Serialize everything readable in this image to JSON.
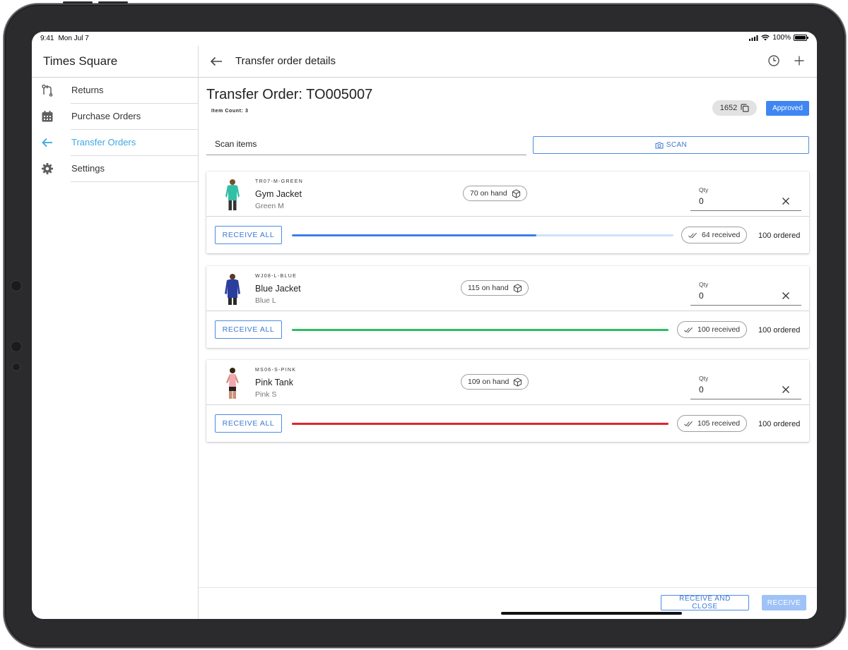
{
  "status_bar": {
    "time": "9:41",
    "date": "Mon Jul 7",
    "battery": "100%"
  },
  "sidebar": {
    "title": "Times Square",
    "items": [
      {
        "label": "Returns",
        "icon": "returns-icon",
        "active": false
      },
      {
        "label": "Purchase Orders",
        "icon": "calendar-icon",
        "active": false
      },
      {
        "label": "Transfer Orders",
        "icon": "arrow-left-icon",
        "active": true
      },
      {
        "label": "Settings",
        "icon": "gear-icon",
        "active": false
      }
    ]
  },
  "header": {
    "title": "Transfer order details"
  },
  "order": {
    "title": "Transfer Order: TO005007",
    "item_count": "Item Count: 3",
    "id_chip": "1652",
    "status": "Approved"
  },
  "scan": {
    "placeholder": "Scan items",
    "button_label": "SCAN"
  },
  "items": [
    {
      "sku": "TR07-M-GREEN",
      "name": "Gym Jacket",
      "variant": "Green M",
      "on_hand": "70 on hand",
      "qty_label": "Qty",
      "qty": "0",
      "receive_all_label": "RECEIVE ALL",
      "progress": 0.64,
      "progress_color": "#3d7fe6",
      "track_color": "#cfe1fb",
      "received": "64 received",
      "ordered": "100 ordered",
      "shirt_color": "#31bfa6"
    },
    {
      "sku": "WJ08-L-BLUE",
      "name": "Blue Jacket",
      "variant": "Blue L",
      "on_hand": "115 on hand",
      "qty_label": "Qty",
      "qty": "0",
      "receive_all_label": "RECEIVE ALL",
      "progress": 1.0,
      "progress_color": "#2ebd63",
      "track_color": "#2ebd63",
      "received": "100 received",
      "ordered": "100 ordered",
      "shirt_color": "#2b3e9e"
    },
    {
      "sku": "MS06-S-PINK",
      "name": "Pink Tank",
      "variant": "Pink S",
      "on_hand": "109 on hand",
      "qty_label": "Qty",
      "qty": "0",
      "receive_all_label": "RECEIVE ALL",
      "progress": 1.05,
      "progress_color": "#e0262b",
      "track_color": "#e0262b",
      "received": "105 received",
      "ordered": "100 ordered",
      "shirt_color": "#f3a5b0"
    }
  ],
  "footer": {
    "receive_close_label": "RECEIVE AND CLOSE",
    "receive_label": "RECEIVE"
  }
}
